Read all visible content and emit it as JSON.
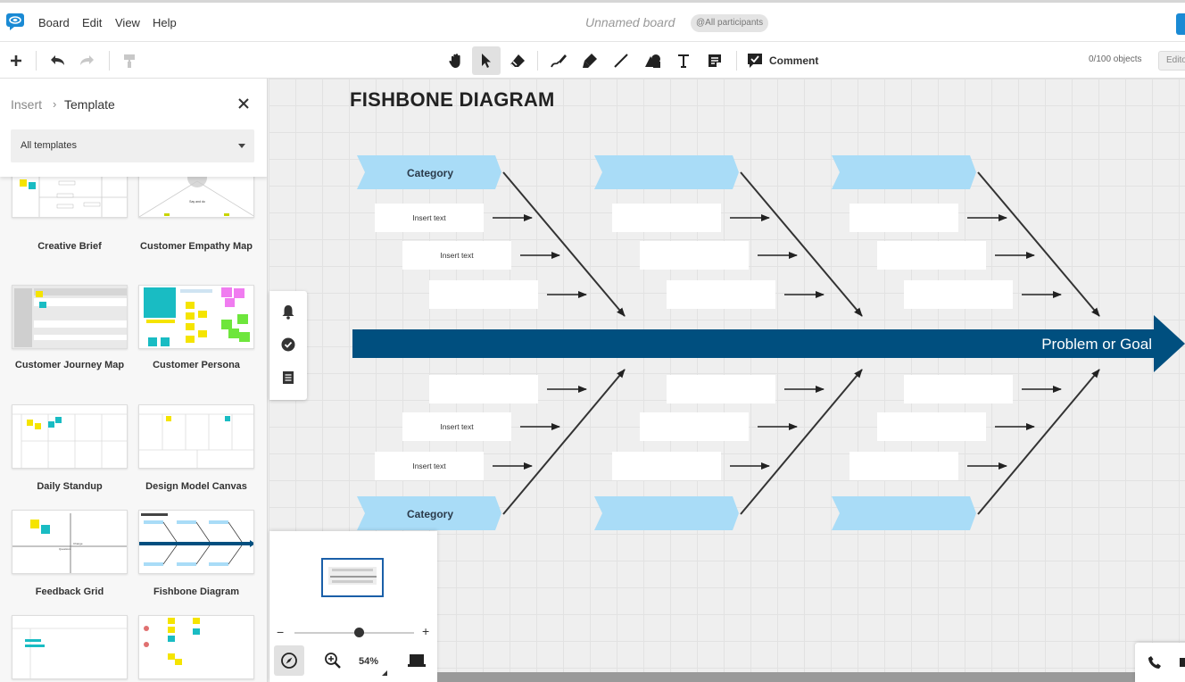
{
  "menubar": {
    "items": [
      "Board",
      "Edit",
      "View",
      "Help"
    ],
    "board_title": "Unnamed board",
    "participants": "@All participants"
  },
  "toolbar": {
    "comment_label": "Comment",
    "objects_count": "0/100 objects",
    "edit_label": "Edito"
  },
  "panel": {
    "breadcrumb_insert": "Insert",
    "breadcrumb_template": "Template",
    "select_value": "All templates",
    "templates": [
      {
        "name": "Creative Brief"
      },
      {
        "name": "Customer Empathy Map"
      },
      {
        "name": "Customer Journey Map"
      },
      {
        "name": "Customer Persona"
      },
      {
        "name": "Daily Standup"
      },
      {
        "name": "Design Model Canvas"
      },
      {
        "name": "Feedback Grid"
      },
      {
        "name": "Fishbone Diagram"
      },
      {
        "name": ""
      },
      {
        "name": ""
      }
    ]
  },
  "diagram": {
    "title": "FISHBONE DIAGRAM",
    "goal": "Problem or Goal",
    "top_categories": [
      "Category",
      "",
      ""
    ],
    "bottom_categories": [
      "Category",
      "",
      ""
    ],
    "top_texts": [
      [
        "Insert text",
        "Insert text",
        ""
      ],
      [
        "",
        "",
        ""
      ],
      [
        "",
        "",
        ""
      ]
    ],
    "bottom_texts": [
      [
        "",
        "Insert text",
        "Insert text"
      ],
      [
        "",
        "",
        ""
      ],
      [
        "",
        "",
        ""
      ]
    ],
    "colors": {
      "spine": "#004f7f",
      "category": "#a9dcf7",
      "text_box": "#ffffff"
    }
  },
  "navigator": {
    "zoom": "54%",
    "zoom_level": 0.54
  }
}
